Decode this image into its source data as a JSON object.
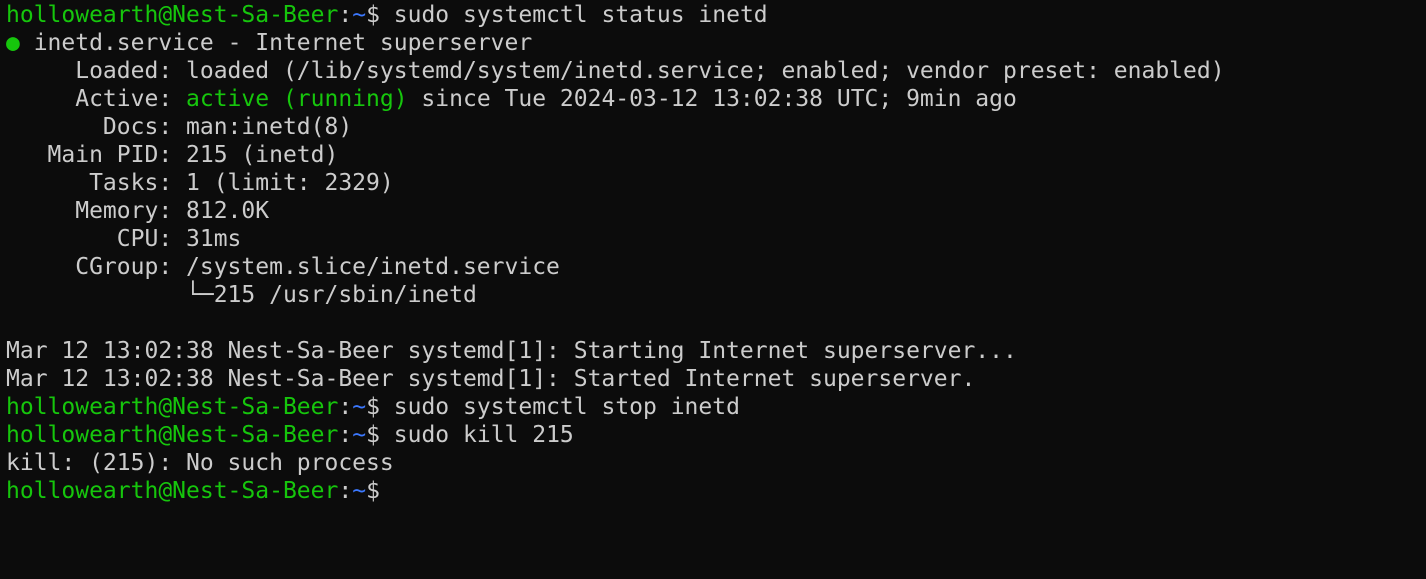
{
  "prompt": {
    "user_host": "hollowearth@Nest-Sa-Beer",
    "sep": ":",
    "path": "~",
    "symbol": "$ "
  },
  "cmd1": "sudo systemctl status inetd",
  "status": {
    "dot": "●",
    "header": " inetd.service - Internet superserver",
    "loaded": "     Loaded: loaded (/lib/systemd/system/inetd.service; enabled; vendor preset: enabled)",
    "active_label": "     Active: ",
    "active_state": "active (running)",
    "active_rest": " since Tue 2024-03-12 13:02:38 UTC; 9min ago",
    "docs": "       Docs: man:inetd(8)",
    "main_pid": "   Main PID: 215 (inetd)",
    "tasks": "      Tasks: 1 (limit: 2329)",
    "memory": "     Memory: 812.0K",
    "cpu": "        CPU: 31ms",
    "cgroup": "     CGroup: /system.slice/inetd.service",
    "cgroup_child": "             └─215 /usr/sbin/inetd"
  },
  "log": [
    "Mar 12 13:02:38 Nest-Sa-Beer systemd[1]: Starting Internet superserver...",
    "Mar 12 13:02:38 Nest-Sa-Beer systemd[1]: Started Internet superserver."
  ],
  "cmd2": "sudo systemctl stop inetd",
  "cmd3": "sudo kill 215",
  "kill_output": "kill: (215): No such process",
  "colors": {
    "background": "#0c0c0c",
    "foreground": "#cccccc",
    "prompt_user": "#16c60c",
    "prompt_path": "#3b78ff",
    "active": "#16c60c"
  }
}
